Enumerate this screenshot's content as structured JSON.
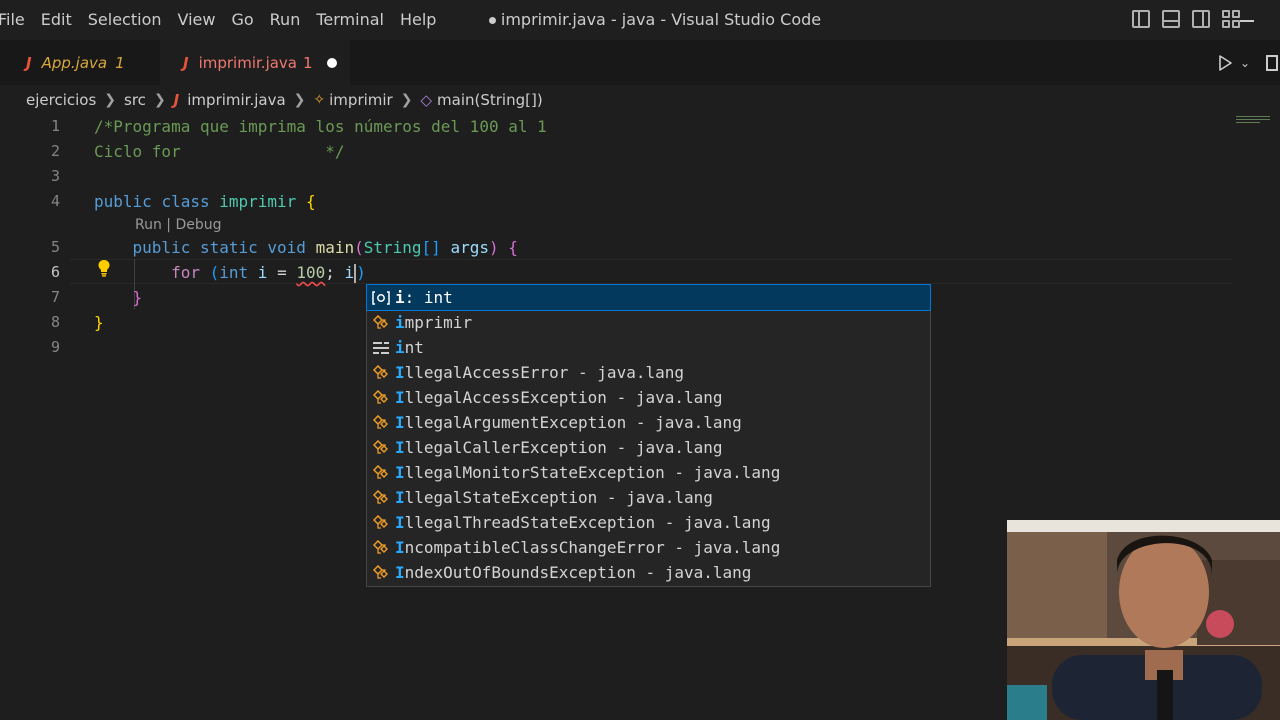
{
  "menu": [
    "File",
    "Edit",
    "Selection",
    "View",
    "Go",
    "Run",
    "Terminal",
    "Help"
  ],
  "window_title": "imprimir.java - java - Visual Studio Code",
  "tabs": [
    {
      "name": "App.java",
      "badge": "1",
      "icon": "java-icon"
    },
    {
      "name": "imprimir.java",
      "badge": "1",
      "icon": "java-icon",
      "active": true,
      "unsaved": true
    }
  ],
  "breadcrumb": {
    "folder1": "ejercicios",
    "folder2": "src",
    "file": "imprimir.java",
    "class": "imprimir",
    "method": "main(String[])"
  },
  "editor": {
    "line_numbers": [
      "1",
      "2",
      "3",
      "4",
      "5",
      "6",
      "7",
      "8",
      "9"
    ],
    "active_line": "6",
    "codelens": "Run | Debug"
  },
  "suggestions": [
    {
      "icon": "variable-icon",
      "match": "i",
      "rest": " : int",
      "selected": true
    },
    {
      "icon": "class-icon",
      "match": "i",
      "rest": "mprimir"
    },
    {
      "icon": "keyword-icon",
      "match": "i",
      "rest": "nt"
    },
    {
      "icon": "class-icon",
      "match": "I",
      "rest": "llegalAccessError - java.lang"
    },
    {
      "icon": "class-icon",
      "match": "I",
      "rest": "llegalAccessException - java.lang"
    },
    {
      "icon": "class-icon",
      "match": "I",
      "rest": "llegalArgumentException - java.lang"
    },
    {
      "icon": "class-icon",
      "match": "I",
      "rest": "llegalCallerException - java.lang"
    },
    {
      "icon": "class-icon",
      "match": "I",
      "rest": "llegalMonitorStateException - java.lang"
    },
    {
      "icon": "class-icon",
      "match": "I",
      "rest": "llegalStateException - java.lang"
    },
    {
      "icon": "class-icon",
      "match": "I",
      "rest": "llegalThreadStateException - java.lang"
    },
    {
      "icon": "class-icon",
      "match": "I",
      "rest": "ncompatibleClassChangeError - java.lang"
    },
    {
      "icon": "class-icon",
      "match": "I",
      "rest": "ndexOutOfBoundsException - java.lang"
    }
  ],
  "colors": {
    "editor_bg": "#1e1e1e",
    "comment": "#6a9955",
    "keyword": "#569cd6",
    "selection": "#04395e"
  }
}
